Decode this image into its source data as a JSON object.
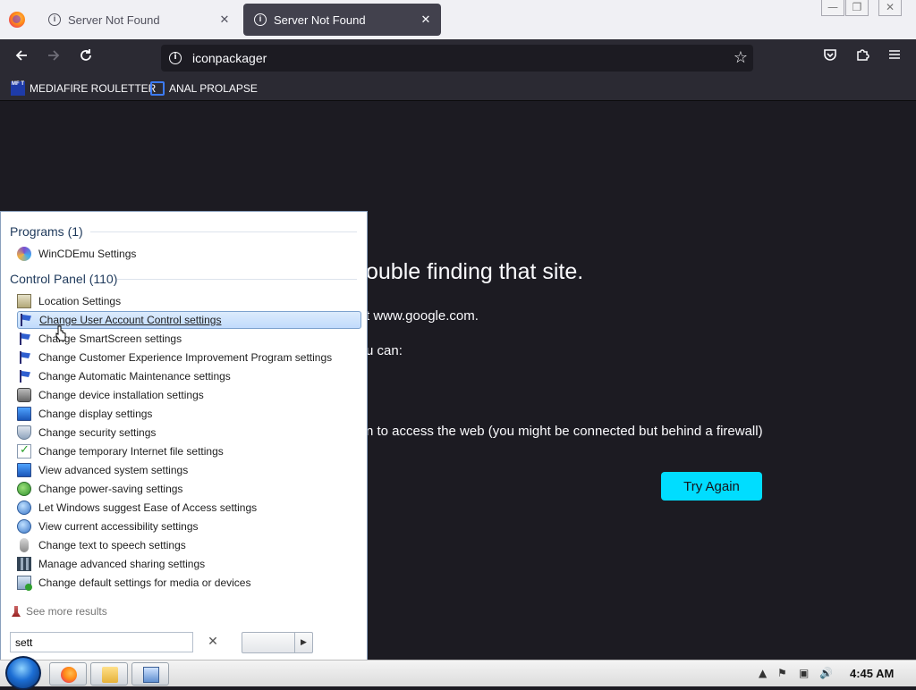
{
  "browser": {
    "tabs": [
      {
        "title": "Server Not Found",
        "close": "✕"
      },
      {
        "title": "Server Not Found",
        "close": "✕"
      }
    ],
    "url": "iconpackager",
    "bookmarks": [
      {
        "label": "MEDIAFIRE ROULETTER",
        "favicon_text": "MF T"
      },
      {
        "label": "ANAL PROLAPSE"
      }
    ],
    "window_controls": [
      "—",
      "❐",
      "✕"
    ]
  },
  "error_page": {
    "heading": "ouble finding that site.",
    "line1": "t www.google.com.",
    "line2": "u can:",
    "line3": "n to access the web (you might be connected but behind a firewall)",
    "try_again": "Try Again"
  },
  "start_menu": {
    "programs_header": "Programs (1)",
    "programs": [
      {
        "label": "WinCDEmu Settings",
        "icon": "wincdemu-icon"
      }
    ],
    "control_panel_header": "Control Panel (110)",
    "control_panel": [
      {
        "label": "Location Settings",
        "icon": "location-icon"
      },
      {
        "label": "Change User Account Control settings",
        "icon": "flag-icon",
        "selected": true
      },
      {
        "label": "Change SmartScreen settings",
        "icon": "flag-icon"
      },
      {
        "label": "Change Customer Experience Improvement Program settings",
        "icon": "flag-icon"
      },
      {
        "label": "Change Automatic Maintenance settings",
        "icon": "flag-icon"
      },
      {
        "label": "Change device installation settings",
        "icon": "camera-icon"
      },
      {
        "label": "Change display settings",
        "icon": "display-icon"
      },
      {
        "label": "Change security settings",
        "icon": "security-icon"
      },
      {
        "label": "Change temporary Internet file settings",
        "icon": "checklist-icon"
      },
      {
        "label": "View advanced system settings",
        "icon": "system-icon"
      },
      {
        "label": "Change power-saving settings",
        "icon": "power-icon"
      },
      {
        "label": "Let Windows suggest Ease of Access settings",
        "icon": "ease-of-access-icon"
      },
      {
        "label": "View current accessibility settings",
        "icon": "ease-of-access-icon"
      },
      {
        "label": "Change text to speech settings",
        "icon": "microphone-icon"
      },
      {
        "label": "Manage advanced sharing settings",
        "icon": "network-icon"
      },
      {
        "label": "Change default settings for media or devices",
        "icon": "media-icon"
      }
    ],
    "see_more": "See more results",
    "search_value": "sett",
    "clear": "✕",
    "shutdown_arrow": "▶"
  },
  "taskbar": {
    "clock": "4:45 AM",
    "tray_icons": [
      "▲",
      "⚑",
      "▣",
      "🔊"
    ]
  }
}
